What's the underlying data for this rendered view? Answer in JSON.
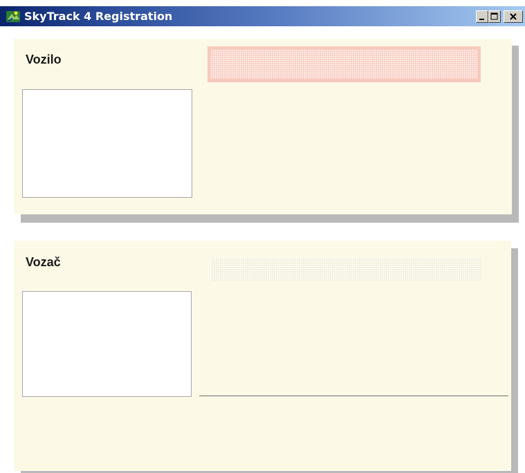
{
  "window": {
    "title": "SkyTrack 4 Registration",
    "icon": "skytrack-app-icon",
    "controls": {
      "minimize_icon": "minimize-icon",
      "maximize_icon": "maximize-icon",
      "close_icon": "close-icon"
    }
  },
  "vehicle_panel": {
    "title": "Vozilo",
    "display_state": "active",
    "display_color": "#f8cabd"
  },
  "driver_panel": {
    "title": "Vozač",
    "display_state": "inactive",
    "display_color": "#f2efd9"
  },
  "colors": {
    "panel_background": "#fcfae6",
    "panel_shadow": "#b9b9b9",
    "titlebar_start": "#0a246a",
    "titlebar_end": "#a6caf0"
  }
}
